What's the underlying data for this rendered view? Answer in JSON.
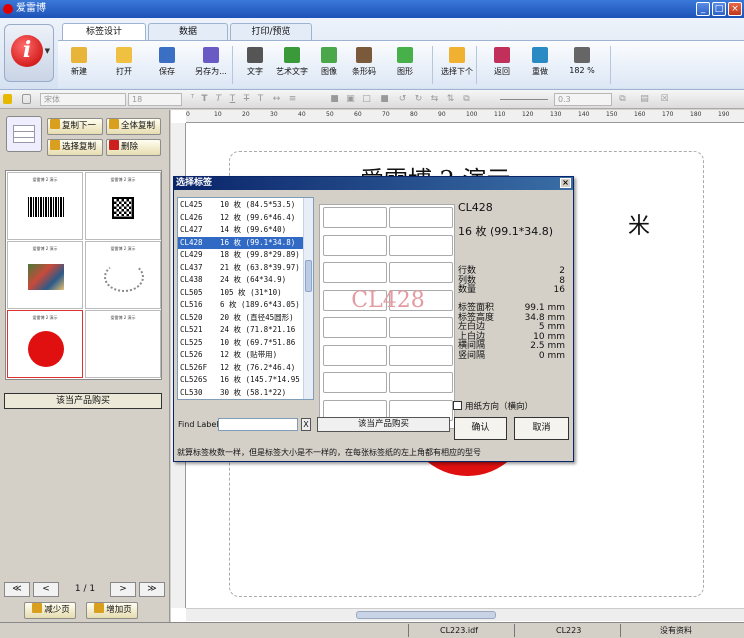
{
  "window": {
    "title": "爱雷博"
  },
  "tabs": [
    {
      "label": "标签设计",
      "active": true
    },
    {
      "label": "数据",
      "active": false
    },
    {
      "label": "打印/预览",
      "active": false
    }
  ],
  "ribbon": {
    "buttons": [
      {
        "label": "新建",
        "icon": "new-icon",
        "color": "#e8b43a"
      },
      {
        "label": "打开",
        "icon": "open-folder-icon",
        "color": "#f0c040"
      },
      {
        "label": "保存",
        "icon": "save-icon",
        "color": "#3a6fc4"
      },
      {
        "label": "另存为...",
        "icon": "save-as-icon",
        "color": "#6a5bc4"
      },
      {
        "label": "文字",
        "icon": "text-icon",
        "color": "#555555"
      },
      {
        "label": "艺术文字",
        "icon": "art-text-icon",
        "color": "#3a9a3a"
      },
      {
        "label": "图像",
        "icon": "image-icon",
        "color": "#4aa84a"
      },
      {
        "label": "条形码",
        "icon": "barcode-icon",
        "color": "#7a5a3a"
      },
      {
        "label": "图形",
        "icon": "shape-icon",
        "color": "#48b048"
      },
      {
        "label": "选择下个",
        "icon": "select-next-icon",
        "color": "#f0b030"
      },
      {
        "label": "返回",
        "icon": "undo-icon",
        "color": "#c0305a"
      },
      {
        "label": "重做",
        "icon": "redo-icon",
        "color": "#2a8ac4"
      },
      {
        "label": "182 %",
        "icon": "zoom-icon",
        "color": "#666666"
      }
    ]
  },
  "toolbar": {
    "font_name": "宋体",
    "font_size": "18",
    "line_width": "0.3"
  },
  "left_panel": {
    "buttons": [
      {
        "label": "复制下一",
        "icon": "copy-next-icon",
        "color": "#d9a020"
      },
      {
        "label": "全体复制",
        "icon": "copy-all-icon",
        "color": "#d9a020"
      },
      {
        "label": "选择复制",
        "icon": "copy-selected-icon",
        "color": "#d9a020"
      },
      {
        "label": "删除",
        "icon": "delete-icon",
        "color": "#cc2020"
      }
    ],
    "thumbnail_caption": "爱雷博 2 演示",
    "buy_label": "该当产品购买",
    "page_indicator": "1 / 1",
    "nav": {
      "first": "≪",
      "prev": "<",
      "next": ">",
      "last": "≫"
    },
    "reduce_page": "减少页",
    "add_page": "增加页"
  },
  "canvas": {
    "ruler_marks": [
      "0",
      "10",
      "20",
      "30",
      "40",
      "50",
      "60",
      "70",
      "80",
      "90",
      "100",
      "110",
      "120",
      "130",
      "140",
      "150",
      "160",
      "170",
      "180",
      "190"
    ],
    "label_text_top": "爱雷博 2 演示",
    "label_text_right": "米"
  },
  "dialog": {
    "title": "选择标签",
    "list": [
      {
        "code": "CL425",
        "qty": "10 枚 (84.5*53.5)"
      },
      {
        "code": "CL426",
        "qty": "12 枚 (99.6*46.4)"
      },
      {
        "code": "CL427",
        "qty": "14 枚 (99.6*40)"
      },
      {
        "code": "CL428",
        "qty": "16 枚 (99.1*34.8)",
        "selected": true
      },
      {
        "code": "CL429",
        "qty": "18 枚 (99.8*29.89)"
      },
      {
        "code": "CL437",
        "qty": "21 枚 (63.8*39.97)"
      },
      {
        "code": "CL438",
        "qty": "24 枚 (64*34.9)"
      },
      {
        "code": "CL505",
        "qty": "105 枚 (31*10)"
      },
      {
        "code": "CL516",
        "qty": "6 枚 (189.6*43.05)"
      },
      {
        "code": "CL520",
        "qty": "20 枚 (直径45圆形)"
      },
      {
        "code": "CL521",
        "qty": "24 枚 (71.8*21.16"
      },
      {
        "code": "CL525",
        "qty": "10 枚 (69.7*51.86"
      },
      {
        "code": "CL526",
        "qty": "12 枚 (贴带用)"
      },
      {
        "code": "CL526F",
        "qty": "12 枚 (76.2*46.4)"
      },
      {
        "code": "CL526S",
        "qty": "16 枚 (145.7*14.95"
      },
      {
        "code": "CL530",
        "qty": "30 枚 (58.1*22)"
      }
    ],
    "preview_watermark": "CL428",
    "selected_code": "CL428",
    "selected_summary": "16 枚 (99.1*34.8)",
    "specs_group1": [
      {
        "label": "行数",
        "value": "2"
      },
      {
        "label": "列数",
        "value": "8"
      },
      {
        "label": "数量",
        "value": "16"
      }
    ],
    "specs_group2": [
      {
        "label": "标签面积",
        "value": "99.1 mm"
      },
      {
        "label": "标签高度",
        "value": "34.8 mm"
      },
      {
        "label": "左白边",
        "value": "5 mm"
      },
      {
        "label": "上白边",
        "value": "10 mm"
      },
      {
        "label": "横间隔",
        "value": "2.5 mm"
      },
      {
        "label": "竖间隔",
        "value": "0 mm"
      }
    ],
    "paper_direction_label": "用纸方向（横向）",
    "find_label": "Find Label",
    "find_clear": "X",
    "buy_label": "该当产品购买",
    "ok_label": "确认",
    "cancel_label": "取消",
    "hint": "就算标签枚数一样，但是标签大小是不一样的，在每张标签纸的左上角都有相应的型号"
  },
  "status": {
    "file1": "CL223.idf",
    "file2": "CL223",
    "data_state": "没有资料"
  }
}
